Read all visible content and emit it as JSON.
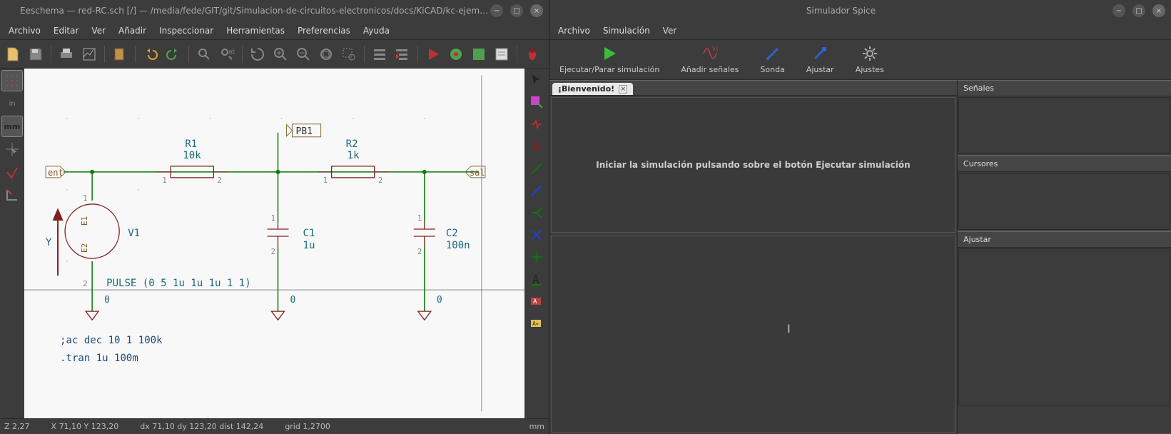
{
  "left_window": {
    "title": "Eeschema — red-RC.sch [/] — /media/fede/GIT/git/Simulacion-de-circuitos-electronicos/docs/KiCAD/kc-ejemplos/red-RC",
    "menus": [
      "Archivo",
      "Editar",
      "Ver",
      "Añadir",
      "Inspeccionar",
      "Herramientas",
      "Preferencias",
      "Ayuda"
    ],
    "schematic": {
      "components": {
        "R1": {
          "ref": "R1",
          "value": "10k"
        },
        "R2": {
          "ref": "R2",
          "value": "1k"
        },
        "C1": {
          "ref": "C1",
          "value": "1u"
        },
        "C2": {
          "ref": "C2",
          "value": "100n"
        },
        "V1": {
          "ref": "V1",
          "pulse": "PULSE (0 5 1u 1u 1u 1 1)"
        }
      },
      "labels": {
        "ent": "ent",
        "sal": "sal",
        "pb1": "PB1",
        "y": "Y"
      },
      "gnd_labels": [
        "0",
        "0",
        "0"
      ],
      "directives": [
        ";ac dec 10 1 100k",
        ".tran 1u 100m"
      ],
      "v1_pins": {
        "top": "E1",
        "bottom": "E2"
      }
    },
    "left_toolbar": {
      "mm": "mm"
    },
    "status": {
      "z": "Z 2,27",
      "xy": "X 71,10  Y 123,20",
      "dxy": "dx 71,10  dy 123,20  dist 142,24",
      "grid": "grid 1,2700",
      "unit": "mm"
    }
  },
  "right_window": {
    "title": "Simulador Spice",
    "menus": [
      "Archivo",
      "Simulación",
      "Ver"
    ],
    "toolbar": {
      "run": "Ejecutar/Parar simulación",
      "add": "Añadir señales",
      "probe": "Sonda",
      "tune": "Ajustar",
      "settings": "Ajustes"
    },
    "tab": "¡Bienvenido!",
    "welcome_msg": "Iniciar la simulación pulsando sobre el botón Ejecutar simulación",
    "panels": {
      "signals": "Señales",
      "cursors": "Cursores",
      "adjust": "Ajustar"
    }
  }
}
